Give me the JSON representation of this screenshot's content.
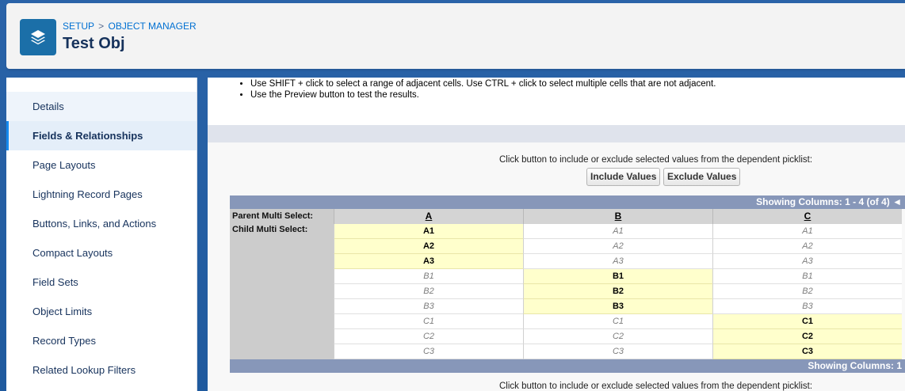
{
  "header": {
    "breadcrumb": [
      "SETUP",
      "OBJECT MANAGER"
    ],
    "separator": ">",
    "title": "Test Obj",
    "icon": "layers-icon"
  },
  "sidebar": {
    "items": [
      {
        "label": "Details"
      },
      {
        "label": "Fields & Relationships"
      },
      {
        "label": "Page Layouts"
      },
      {
        "label": "Lightning Record Pages"
      },
      {
        "label": "Buttons, Links, and Actions"
      },
      {
        "label": "Compact Layouts"
      },
      {
        "label": "Field Sets"
      },
      {
        "label": "Object Limits"
      },
      {
        "label": "Record Types"
      },
      {
        "label": "Related Lookup Filters"
      }
    ]
  },
  "main": {
    "tips": [
      "Use SHIFT + click to select a range of adjacent cells. Use CTRL + click to select multiple cells that are not adjacent.",
      "Use the Preview button to test the results."
    ],
    "instruction": "Click button to include or exclude selected values from the dependent picklist:",
    "include_label": "Include Values",
    "exclude_label": "Exclude Values",
    "showing_top": "Showing Columns: 1 - 4 (of 4) ◄",
    "showing_bottom": "Showing Columns: 1",
    "parent_label": "Parent Multi Select:",
    "child_label": "Child Multi Select:",
    "columns": [
      "A",
      "B",
      "C"
    ],
    "rows": [
      [
        "A1",
        "A1",
        "A1"
      ],
      [
        "A2",
        "A2",
        "A2"
      ],
      [
        "A3",
        "A3",
        "A3"
      ],
      [
        "B1",
        "B1",
        "B1"
      ],
      [
        "B2",
        "B2",
        "B2"
      ],
      [
        "B3",
        "B3",
        "B3"
      ],
      [
        "C1",
        "C1",
        "C1"
      ],
      [
        "C2",
        "C2",
        "C2"
      ],
      [
        "C3",
        "C3",
        "C3"
      ]
    ],
    "included": [
      [
        true,
        false,
        false
      ],
      [
        true,
        false,
        false
      ],
      [
        true,
        false,
        false
      ],
      [
        false,
        true,
        false
      ],
      [
        false,
        true,
        false
      ],
      [
        false,
        true,
        false
      ],
      [
        false,
        false,
        true
      ],
      [
        false,
        false,
        true
      ],
      [
        false,
        false,
        true
      ]
    ],
    "instruction_bottom": "Click button to include or exclude selected values from the dependent picklist:"
  }
}
